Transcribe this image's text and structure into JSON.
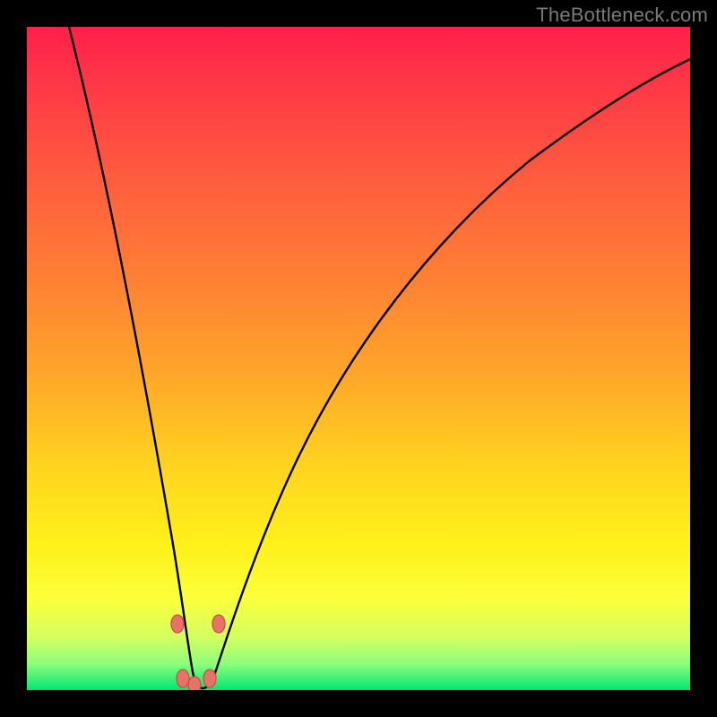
{
  "watermark": "TheBottleneck.com",
  "colors": {
    "background": "#000000",
    "curve_stroke": "#000000",
    "marker_fill": "#e77268",
    "marker_stroke": "#c94f44",
    "gradient_top": "#ff1f4b",
    "gradient_mid": "#ffd31f",
    "gradient_bottom": "#00e676"
  },
  "chart_data": {
    "type": "line",
    "title": "",
    "xlabel": "",
    "ylabel": "",
    "xlim": [
      0,
      100
    ],
    "ylim": [
      0,
      100
    ],
    "x": [
      6,
      10,
      14,
      18,
      20,
      22,
      23,
      24,
      25,
      26,
      27,
      28,
      30,
      34,
      38,
      44,
      52,
      60,
      70,
      80,
      90,
      100
    ],
    "values": [
      100,
      77,
      55,
      33,
      22,
      11,
      6,
      2,
      0,
      0,
      2,
      5,
      10,
      20,
      30,
      42,
      55,
      65,
      75,
      83,
      89,
      94
    ],
    "minimum_x": 25,
    "minimum_value": 0,
    "annotations": [
      {
        "x": 22.5,
        "y": 10,
        "kind": "marker"
      },
      {
        "x": 28.7,
        "y": 10,
        "kind": "marker"
      },
      {
        "x": 23.3,
        "y": 1.8,
        "kind": "marker"
      },
      {
        "x": 25.0,
        "y": 0.6,
        "kind": "marker"
      },
      {
        "x": 27.4,
        "y": 1.8,
        "kind": "marker"
      }
    ]
  }
}
